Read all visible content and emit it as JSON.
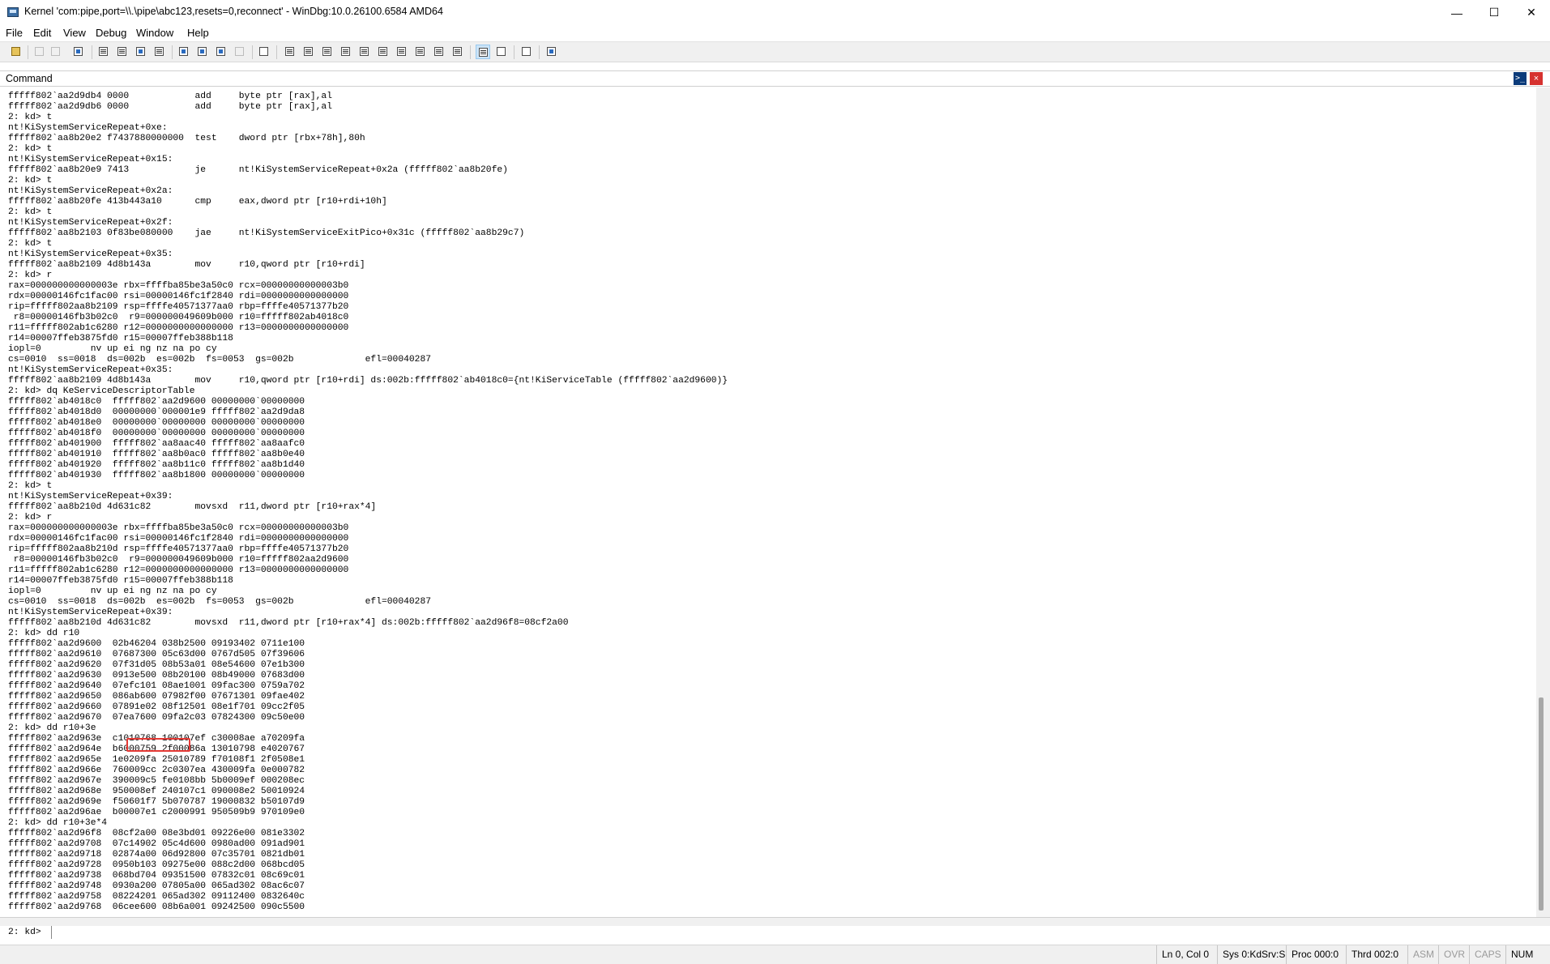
{
  "window": {
    "title": "Kernel 'com:pipe,port=\\\\.\\pipe\\abc123,resets=0,reconnect' - WinDbg:10.0.26100.6584 AMD64",
    "minimize_glyph": "—",
    "maximize_glyph": "☐",
    "close_glyph": "✕"
  },
  "menu": [
    "File",
    "Edit",
    "View",
    "Debug",
    "Window",
    "Help"
  ],
  "toolbar": {
    "icons": [
      "open-folder-icon",
      "cut-icon",
      "copy-icon",
      "paste-icon",
      "go-icon",
      "restart-icon",
      "stop-debugging-icon",
      "break-icon",
      "step-into-icon",
      "step-over-icon",
      "step-out-icon",
      "run-to-cursor-icon",
      "source-mode-icon",
      "command-window-icon",
      "watch-window-icon",
      "locals-window-icon",
      "registers-window-icon",
      "memory-window-icon",
      "call-stack-window-icon",
      "disassembly-window-icon",
      "scratch-pad-icon",
      "source-mode-on-icon",
      "hex-mode-icon",
      "font-icon",
      "options-icon"
    ]
  },
  "command_window": {
    "title": "Command",
    "highlight": "08cf2a00",
    "lines": [
      "fffff802`aa2d9db4 0000            add     byte ptr [rax],al",
      "fffff802`aa2d9db6 0000            add     byte ptr [rax],al",
      "2: kd> t",
      "nt!KiSystemServiceRepeat+0xe:",
      "fffff802`aa8b20e2 f7437880000000  test    dword ptr [rbx+78h],80h",
      "2: kd> t",
      "nt!KiSystemServiceRepeat+0x15:",
      "fffff802`aa8b20e9 7413            je      nt!KiSystemServiceRepeat+0x2a (fffff802`aa8b20fe)",
      "2: kd> t",
      "nt!KiSystemServiceRepeat+0x2a:",
      "fffff802`aa8b20fe 413b443a10      cmp     eax,dword ptr [r10+rdi+10h]",
      "2: kd> t",
      "nt!KiSystemServiceRepeat+0x2f:",
      "fffff802`aa8b2103 0f83be080000    jae     nt!KiSystemServiceExitPico+0x31c (fffff802`aa8b29c7)",
      "2: kd> t",
      "nt!KiSystemServiceRepeat+0x35:",
      "fffff802`aa8b2109 4d8b143a        mov     r10,qword ptr [r10+rdi]",
      "2: kd> r",
      "rax=000000000000003e rbx=ffffba85be3a50c0 rcx=00000000000003b0",
      "rdx=00000146fc1fac00 rsi=00000146fc1f2840 rdi=0000000000000000",
      "rip=fffff802aa8b2109 rsp=ffffe40571377aa0 rbp=ffffe40571377b20",
      " r8=00000146fb3b02c0  r9=000000049609b000 r10=fffff802ab4018c0",
      "r11=fffff802ab1c6280 r12=0000000000000000 r13=0000000000000000",
      "r14=00007ffeb3875fd0 r15=00007ffeb388b118",
      "iopl=0         nv up ei ng nz na po cy",
      "cs=0010  ss=0018  ds=002b  es=002b  fs=0053  gs=002b             efl=00040287",
      "nt!KiSystemServiceRepeat+0x35:",
      "fffff802`aa8b2109 4d8b143a        mov     r10,qword ptr [r10+rdi] ds:002b:fffff802`ab4018c0={nt!KiServiceTable (fffff802`aa2d9600)}",
      "2: kd> dq KeServiceDescriptorTable",
      "fffff802`ab4018c0  fffff802`aa2d9600 00000000`00000000",
      "fffff802`ab4018d0  00000000`000001e9 fffff802`aa2d9da8",
      "fffff802`ab4018e0  00000000`00000000 00000000`00000000",
      "fffff802`ab4018f0  00000000`00000000 00000000`00000000",
      "fffff802`ab401900  fffff802`aa8aac40 fffff802`aa8aafc0",
      "fffff802`ab401910  fffff802`aa8b0ac0 fffff802`aa8b0e40",
      "fffff802`ab401920  fffff802`aa8b11c0 fffff802`aa8b1d40",
      "fffff802`ab401930  fffff802`aa8b1800 00000000`00000000",
      "2: kd> t",
      "nt!KiSystemServiceRepeat+0x39:",
      "fffff802`aa8b210d 4d631c82        movsxd  r11,dword ptr [r10+rax*4]",
      "2: kd> r",
      "rax=000000000000003e rbx=ffffba85be3a50c0 rcx=00000000000003b0",
      "rdx=00000146fc1fac00 rsi=00000146fc1f2840 rdi=0000000000000000",
      "rip=fffff802aa8b210d rsp=ffffe40571377aa0 rbp=ffffe40571377b20",
      " r8=00000146fb3b02c0  r9=000000049609b000 r10=fffff802aa2d9600",
      "r11=fffff802ab1c6280 r12=0000000000000000 r13=0000000000000000",
      "r14=00007ffeb3875fd0 r15=00007ffeb388b118",
      "iopl=0         nv up ei ng nz na po cy",
      "cs=0010  ss=0018  ds=002b  es=002b  fs=0053  gs=002b             efl=00040287",
      "nt!KiSystemServiceRepeat+0x39:",
      "fffff802`aa8b210d 4d631c82        movsxd  r11,dword ptr [r10+rax*4] ds:002b:fffff802`aa2d96f8=08cf2a00",
      "2: kd> dd r10",
      "fffff802`aa2d9600  02b46204 038b2500 09193402 0711e100",
      "fffff802`aa2d9610  07687300 05c63d00 0767d505 07f39606",
      "fffff802`aa2d9620  07f31d05 08b53a01 08e54600 07e1b300",
      "fffff802`aa2d9630  0913e500 08b20100 08b49000 07683d00",
      "fffff802`aa2d9640  07efc101 08ae1001 09fac300 0759a702",
      "fffff802`aa2d9650  086ab600 07982f00 07671301 09fae402",
      "fffff802`aa2d9660  07891e02 08f12501 08e1f701 09cc2f05",
      "fffff802`aa2d9670  07ea7600 09fa2c03 07824300 09c50e00",
      "2: kd> dd r10+3e",
      "fffff802`aa2d963e  c1010768 100107ef c30008ae a70209fa",
      "fffff802`aa2d964e  b6000759 2f00086a 13010798 e4020767",
      "fffff802`aa2d965e  1e0209fa 25010789 f70108f1 2f0508e1",
      "fffff802`aa2d966e  760009cc 2c0307ea 430009fa 0e000782",
      "fffff802`aa2d967e  390009c5 fe0108bb 5b0009ef 000208ec",
      "fffff802`aa2d968e  950008ef 240107c1 090008e2 50010924",
      "fffff802`aa2d969e  f50601f7 5b070787 19000832 b50107d9",
      "fffff802`aa2d96ae  b00007e1 c2000991 950509b9 970109e0",
      "2: kd> dd r10+3e*4",
      "fffff802`aa2d96f8  08cf2a00 08e3bd01 09226e00 081e3302",
      "fffff802`aa2d9708  07c14902 05c4d600 0980ad00 091ad901",
      "fffff802`aa2d9718  02874a00 06d92800 07c35701 0821db01",
      "fffff802`aa2d9728  0950b103 09275e00 088c2d00 068bcd05",
      "fffff802`aa2d9738  068bd704 09351500 07832c01 08c69c01",
      "fffff802`aa2d9748  0930a200 07805a00 065ad302 08ac6c07",
      "fffff802`aa2d9758  08224201 065ad302 09112400 0832640c",
      "fffff802`aa2d9768  06cee600 08b6a001 09242500 090c5500"
    ],
    "prompt": "2: kd>",
    "input_value": ""
  },
  "statusbar": {
    "position": "Ln 0, Col 0",
    "sys": "Sys 0:KdSrv:S",
    "proc": "Proc 000:0",
    "thrd": "Thrd 002:0",
    "asm": "ASM",
    "ovr": "OVR",
    "caps": "CAPS",
    "num": "NUM"
  }
}
